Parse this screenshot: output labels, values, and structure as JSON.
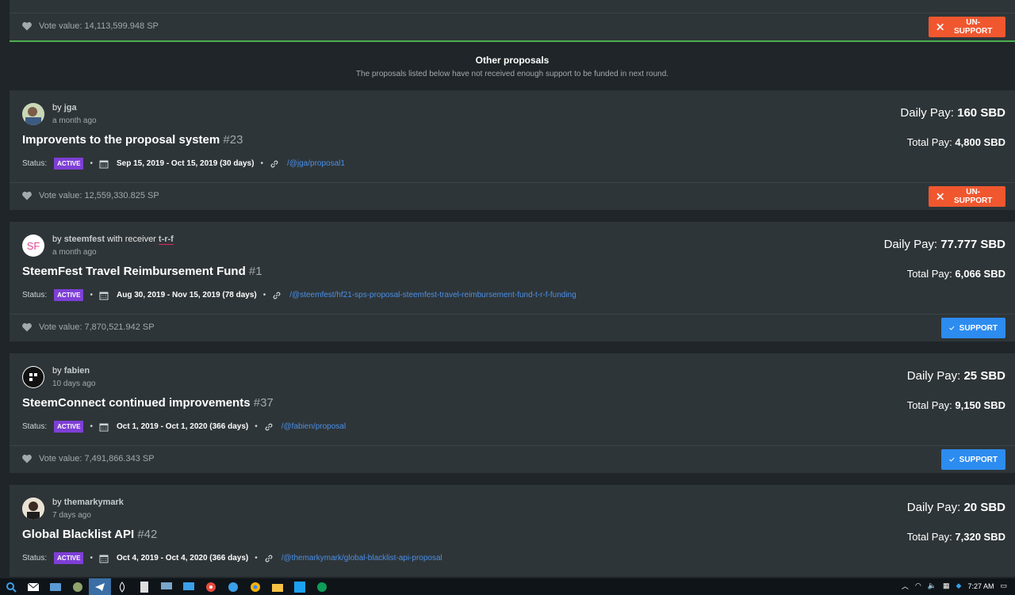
{
  "first_vote": {
    "vote_label": "Vote value: 14,113,599.948 SP",
    "button": "UN-SUPPORT"
  },
  "section": {
    "title": "Other proposals",
    "subtitle": "The proposals listed below have not received enough support to be funded in next round."
  },
  "proposals": [
    {
      "by": "by ",
      "user": "jga",
      "with_receiver": "",
      "receiver": "",
      "ago": "a month ago",
      "title": "Improvents to the proposal system",
      "number": "#23",
      "status_label": "Status:",
      "status": "ACTIVE",
      "dates": "Sep 15, 2019 - Oct 15, 2019 (30 days)",
      "link": "/@jga/proposal1",
      "daily_label": "Daily Pay:",
      "daily": "160 SBD",
      "total_label": "Total Pay:",
      "total": "4,800 SBD",
      "vote": "Vote value: 12,559,330.825 SP",
      "button": "UN-SUPPORT",
      "avatar_text": ""
    },
    {
      "by": "by ",
      "user": "steemfest",
      "with_receiver": " with receiver ",
      "receiver": "t-r-f",
      "ago": "a month ago",
      "title": "SteemFest Travel Reimbursement Fund",
      "number": "#1",
      "status_label": "Status:",
      "status": "ACTIVE",
      "dates": "Aug 30, 2019 - Nov 15, 2019 (78 days)",
      "link": "/@steemfest/hf21-sps-proposal-steemfest-travel-reimbursement-fund-t-r-f-funding",
      "daily_label": "Daily Pay:",
      "daily": "77.777 SBD",
      "total_label": "Total Pay:",
      "total": "6,066 SBD",
      "vote": "Vote value: 7,870,521.942 SP",
      "button": "SUPPORT",
      "avatar_text": "SF"
    },
    {
      "by": "by ",
      "user": "fabien",
      "with_receiver": "",
      "receiver": "",
      "ago": "10 days ago",
      "title": "SteemConnect continued improvements",
      "number": "#37",
      "status_label": "Status:",
      "status": "ACTIVE",
      "dates": "Oct 1, 2019 - Oct 1, 2020 (366 days)",
      "link": "/@fabien/proposal",
      "daily_label": "Daily Pay:",
      "daily": "25 SBD",
      "total_label": "Total Pay:",
      "total": "9,150 SBD",
      "vote": "Vote value: 7,491,866.343 SP",
      "button": "SUPPORT",
      "avatar_text": ""
    },
    {
      "by": "by ",
      "user": "themarkymark",
      "with_receiver": "",
      "receiver": "",
      "ago": "7 days ago",
      "title": "Global Blacklist API",
      "number": "#42",
      "status_label": "Status:",
      "status": "ACTIVE",
      "dates": "Oct 4, 2019 - Oct 4, 2020 (366 days)",
      "link": "/@themarkymark/global-blacklist-api-proposal",
      "daily_label": "Daily Pay:",
      "daily": "20 SBD",
      "total_label": "Total Pay:",
      "total": "7,320 SBD",
      "avatar_text": ""
    }
  ],
  "taskbar": {
    "time": "7:27 AM"
  }
}
